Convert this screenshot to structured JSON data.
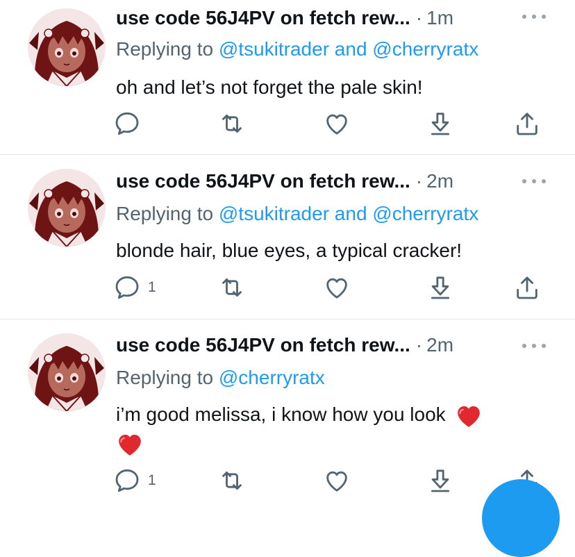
{
  "colors": {
    "accent": "#1d9bf0",
    "muted": "#536471",
    "text": "#0f1419",
    "heart_emoji": "#e0282e"
  },
  "tweets": [
    {
      "name": "use code 56J4PV on fetch rew...",
      "dot": "·",
      "time": "1m",
      "replying_prefix": "Replying to",
      "mention_1": "@tsukitrader",
      "and": "and",
      "mention_2": "@cherryratx",
      "text": "oh and let’s not forget the pale skin!",
      "reply_count": "",
      "icons": [
        "reply-icon",
        "retweet-icon",
        "like-icon",
        "download-icon",
        "share-icon"
      ]
    },
    {
      "name": "use code 56J4PV on fetch rew...",
      "dot": "·",
      "time": "2m",
      "replying_prefix": "Replying to",
      "mention_1": "@tsukitrader",
      "and": "and",
      "mention_2": "@cherryratx",
      "text": "blonde hair, blue eyes, a typical cracker!",
      "reply_count": "1",
      "icons": [
        "reply-icon",
        "retweet-icon",
        "like-icon",
        "download-icon",
        "share-icon"
      ]
    },
    {
      "name": "use code 56J4PV on fetch rew...",
      "dot": "·",
      "time": "2m",
      "replying_prefix": "Replying to",
      "mention_1": "@cherryratx",
      "text": "i’m good melissa, i know how you look",
      "emoji": "red-heart-emoji",
      "reply_count": "1",
      "icons": [
        "reply-icon",
        "retweet-icon",
        "like-icon",
        "download-icon",
        "share-icon"
      ]
    }
  ]
}
